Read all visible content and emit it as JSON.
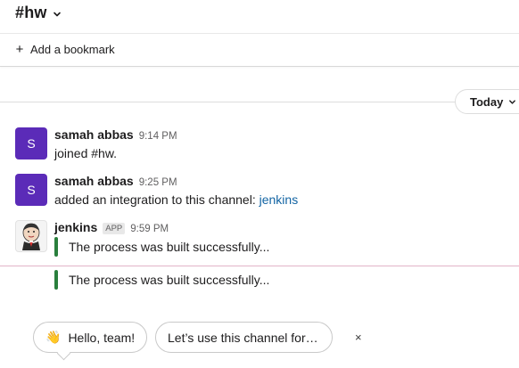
{
  "header": {
    "channel_prefix": "#",
    "channel_name": "hw"
  },
  "bookmarks": {
    "add_label": "Add a bookmark",
    "plus_glyph": "+"
  },
  "day_divider": {
    "label": "Today"
  },
  "messages": [
    {
      "avatar_initial": "S",
      "sender": "samah abbas",
      "time": "9:14 PM",
      "text": "joined #hw."
    },
    {
      "avatar_initial": "S",
      "sender": "samah abbas",
      "time": "9:25 PM",
      "text": "added an integration to this channel: ",
      "link": "jenkins"
    },
    {
      "sender": "jenkins",
      "badge": "APP",
      "time": "9:59 PM",
      "attachments": [
        "The process was built successfully...",
        "The process was built successfully..."
      ]
    }
  ],
  "suggestions": {
    "chips": [
      "Hello, team!",
      "Let’s use this channel for…"
    ],
    "wave_glyph": "👋",
    "dismiss_glyph": "×"
  },
  "colors": {
    "avatar_purple": "#5b2bb8",
    "link_blue": "#1264a3",
    "attachment_green": "#2a7f3d",
    "new_divider": "#e2b4c8"
  }
}
